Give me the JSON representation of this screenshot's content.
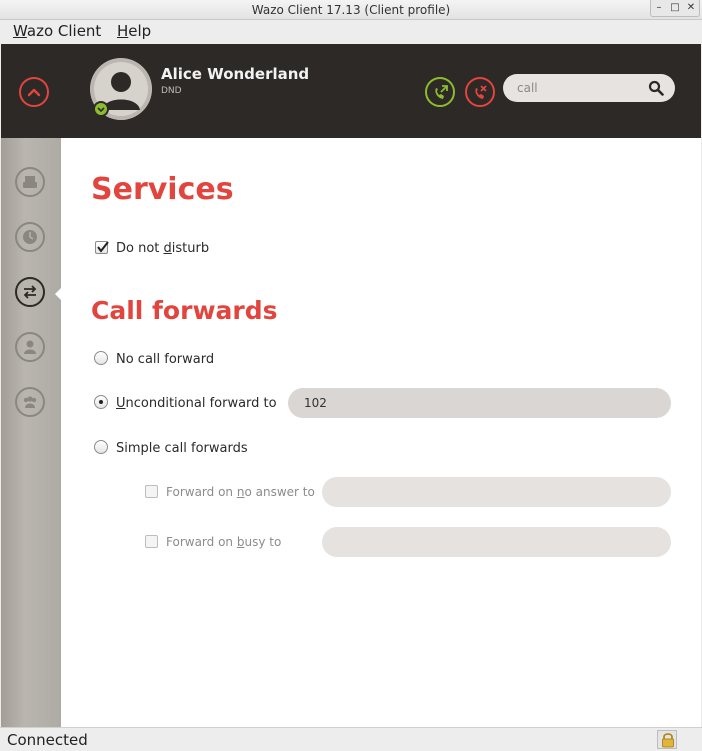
{
  "window": {
    "title": "Wazo Client 17.13 (Client profile)"
  },
  "menubar": {
    "items": [
      {
        "label": "Wazo Client",
        "mnemonic": "W",
        "rest": "azo Client"
      },
      {
        "label": "Help",
        "mnemonic": "H",
        "rest": "elp"
      }
    ]
  },
  "header": {
    "user_name": "Alice Wonderland",
    "user_status": "DND",
    "search_value": "call",
    "icons": [
      "collapse-icon",
      "call-forward-icon",
      "hangup-icon",
      "search-icon"
    ],
    "colors": {
      "background": "#2d2926",
      "accent_red": "#e2453d",
      "accent_green": "#8cbd2c"
    }
  },
  "sidebar": {
    "items": [
      {
        "name": "phonebook",
        "icon": "phonebook-icon"
      },
      {
        "name": "history",
        "icon": "clock-icon"
      },
      {
        "name": "services",
        "icon": "transfer-arrows-icon",
        "active": true
      },
      {
        "name": "contact",
        "icon": "person-icon"
      },
      {
        "name": "people",
        "icon": "group-icon"
      }
    ]
  },
  "services": {
    "heading": "Services",
    "dnd_label_pre": "Do not ",
    "dnd_label_mn": "d",
    "dnd_label_post": "isturb",
    "dnd_checked": true
  },
  "call_forwards": {
    "heading": "Call forwards",
    "no_forward_label": "No call forward",
    "unconditional_label_mn": "U",
    "unconditional_label_rest": "nconditional forward to",
    "unconditional_value": "102",
    "unconditional_selected": true,
    "simple_label": "Simple call forwards",
    "no_answer_pre": "Forward on ",
    "no_answer_mn": "n",
    "no_answer_post": "o answer to",
    "no_answer_value": "",
    "busy_pre": "Forward on ",
    "busy_mn": "b",
    "busy_post": "usy to",
    "busy_value": ""
  },
  "statusbar": {
    "text": "Connected",
    "icon": "lock-icon"
  }
}
